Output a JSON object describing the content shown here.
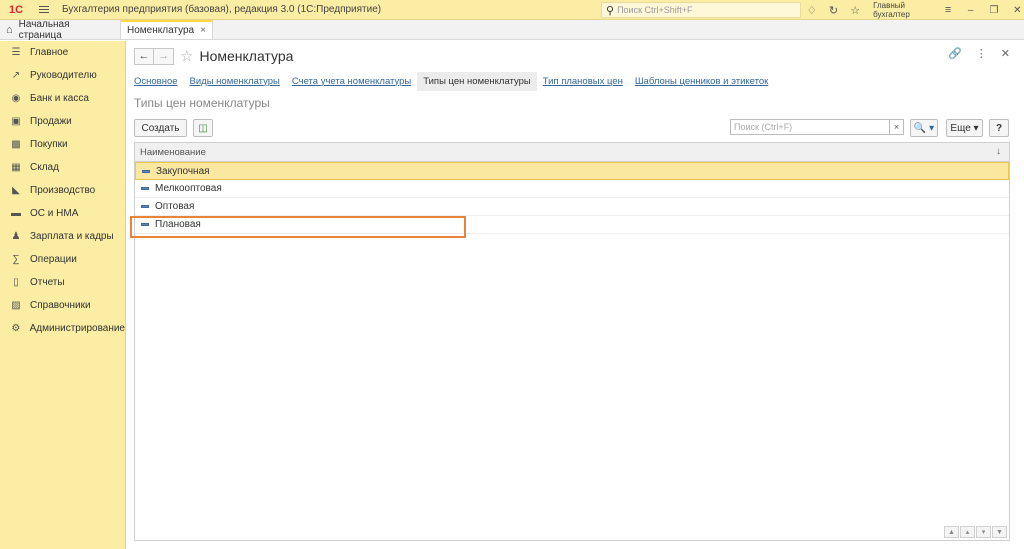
{
  "app": {
    "logo": "1С",
    "title": "Бухгалтерия предприятия (базовая), редакция 3.0  (1С:Предприятие)",
    "search_placeholder": "Поиск Ctrl+Shift+F",
    "user": "Главный бухгалтер"
  },
  "tabs": {
    "home": "Начальная страница",
    "active": "Номенклатура",
    "close": "×"
  },
  "sidebar": {
    "items": [
      {
        "label": "Главное",
        "icon": "menu-icon"
      },
      {
        "label": "Руководителю",
        "icon": "chart-line-icon"
      },
      {
        "label": "Банк и касса",
        "icon": "coin-icon"
      },
      {
        "label": "Продажи",
        "icon": "bag-icon"
      },
      {
        "label": "Покупки",
        "icon": "cart-icon"
      },
      {
        "label": "Склад",
        "icon": "warehouse-icon"
      },
      {
        "label": "Производство",
        "icon": "factory-icon"
      },
      {
        "label": "ОС и НМА",
        "icon": "truck-icon"
      },
      {
        "label": "Зарплата и кадры",
        "icon": "person-icon"
      },
      {
        "label": "Операции",
        "icon": "operations-icon"
      },
      {
        "label": "Отчеты",
        "icon": "report-icon"
      },
      {
        "label": "Справочники",
        "icon": "book-icon"
      },
      {
        "label": "Администрирование",
        "icon": "gear-icon"
      }
    ]
  },
  "form": {
    "back": "←",
    "forward": "→",
    "title": "Номенклатура",
    "subtabs": [
      {
        "label": "Основное",
        "active": false
      },
      {
        "label": "Виды номенклатуры",
        "active": false
      },
      {
        "label": "Счета учета номенклатуры",
        "active": false
      },
      {
        "label": "Типы цен номенклатуры",
        "active": true
      },
      {
        "label": "Тип плановых цен",
        "active": false
      },
      {
        "label": "Шаблоны ценников и этикеток",
        "active": false
      }
    ],
    "list_title": "Типы цен номенклатуры"
  },
  "toolbar": {
    "create_label": "Создать",
    "search_placeholder": "Поиск (Ctrl+F)",
    "clear": "×",
    "search_btn": "🔍 ▾",
    "more_label": "Еще ▾",
    "help_label": "?"
  },
  "grid": {
    "column_header": "Наименование",
    "sort_glyph": "↓",
    "rows": [
      {
        "name": "Закупочная",
        "selected": true
      },
      {
        "name": "Мелкооптовая",
        "selected": false
      },
      {
        "name": "Оптовая",
        "selected": false
      },
      {
        "name": "Плановая",
        "selected": false,
        "highlighted": true
      }
    ]
  }
}
